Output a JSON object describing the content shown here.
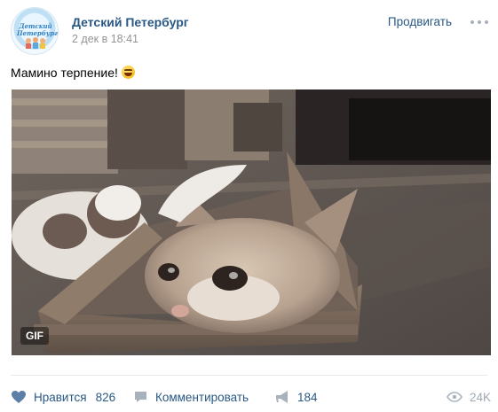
{
  "post": {
    "group_name": "Детский Петербург",
    "date": "2 дек в 18:41",
    "promote_label": "Продвигать",
    "text": "Мамино терпение!",
    "avatar_text": "Детский Петербург"
  },
  "media": {
    "badge": "GIF"
  },
  "actions": {
    "like_label": "Нравится",
    "like_count": "826",
    "comment_label": "Комментировать",
    "share_count": "184",
    "views_count": "24K"
  },
  "colors": {
    "link": "#2a5885",
    "muted": "#939393",
    "icon": "#a8b2bd"
  },
  "icons": [
    "more-icon",
    "emoji-icon",
    "heart-icon",
    "comment-icon",
    "share-icon",
    "eye-icon"
  ]
}
